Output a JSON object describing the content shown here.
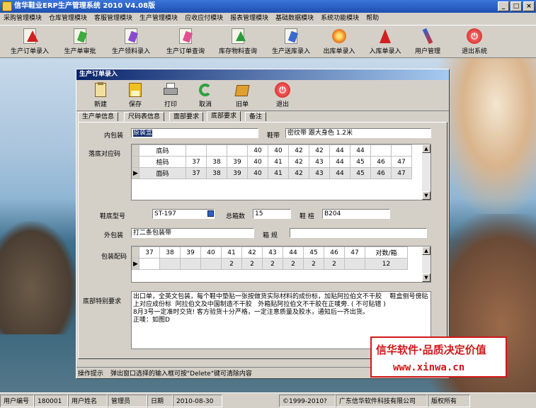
{
  "app": {
    "title": "信华鞋业ERP生产管理系统   2010 V4.08版",
    "controls": [
      "_",
      "□",
      "×"
    ]
  },
  "menu": [
    "采购管理模块",
    "仓库管理模块",
    "客服管理模块",
    "生产管理模块",
    "应收应付模块",
    "报表管理模块",
    "基础数据模块",
    "系统功能模块",
    "帮助"
  ],
  "toolbar": [
    {
      "label": "生产订单录入",
      "icon": "document-red-arrow-icon"
    },
    {
      "label": "生产单审批",
      "icon": "document-green-icon"
    },
    {
      "label": "生产领料录入",
      "icon": "document-purple-icon"
    },
    {
      "label": "生产订单查询",
      "icon": "document-pink-icon"
    },
    {
      "label": "库存物料查询",
      "icon": "document-green-arrow-icon"
    },
    {
      "label": "生产送库录入",
      "icon": "document-blue-icon"
    },
    {
      "label": "出库单录入",
      "icon": "orange-flower-icon"
    },
    {
      "label": "入库单录入",
      "icon": "red-arrow-icon"
    },
    {
      "label": "用户管理",
      "icon": "pen-icon"
    },
    {
      "label": "退出系统",
      "icon": "power-icon"
    }
  ],
  "child": {
    "title": "生产订单录入",
    "buttons": [
      {
        "label": "新建",
        "icon": "clipboard-icon"
      },
      {
        "label": "保存",
        "icon": "save-icon"
      },
      {
        "label": "打印",
        "icon": "printer-icon"
      },
      {
        "label": "取消",
        "icon": "undo-icon"
      },
      {
        "label": "旧单",
        "icon": "books-icon"
      },
      {
        "label": "退出",
        "icon": "power-icon"
      }
    ],
    "tabs": [
      "生产单信息",
      "尺码表信息",
      "面部要求",
      "底部要求",
      "备注"
    ],
    "active_tab": 3
  },
  "form": {
    "inner_pack_label": "内包装",
    "inner_pack_value": "原装盒",
    "shoelace_label": "鞋带",
    "shoelace_value": "密纹带 跟大身色  1.2米",
    "sole_size_label": "落底对应码",
    "size_grid": {
      "rows": [
        {
          "name": "底码",
          "values": [
            "",
            "",
            "",
            "40",
            "40",
            "42",
            "42",
            "44",
            "44",
            "",
            ""
          ],
          "marker": ""
        },
        {
          "name": "楦码",
          "values": [
            "37",
            "38",
            "39",
            "40",
            "41",
            "42",
            "43",
            "44",
            "45",
            "46",
            "47"
          ],
          "marker": ""
        },
        {
          "name": "面码",
          "values": [
            "37",
            "38",
            "39",
            "40",
            "41",
            "42",
            "43",
            "44",
            "45",
            "46",
            "47"
          ],
          "marker": "▶"
        }
      ]
    },
    "sole_model_label": "鞋底型号",
    "sole_model_value": "ST-197",
    "total_boxes_label": "总箱数",
    "total_boxes_value": "15",
    "last_label": "鞋 楦",
    "last_value": "B204",
    "outer_pack_label": "外包装",
    "outer_pack_value": "打二条包装带",
    "box_spec_label": "箱 规",
    "box_spec_value": "",
    "pack_size_label": "包装配码",
    "pack_grid": {
      "headers": [
        "37",
        "38",
        "39",
        "40",
        "41",
        "42",
        "43",
        "44",
        "45",
        "46",
        "47",
        "对数/箱"
      ],
      "row": [
        "",
        "",
        "",
        "",
        "2",
        "2",
        "2",
        "2",
        "2",
        "2",
        "",
        "12"
      ]
    },
    "bottom_req_label": "底部特别要求",
    "bottom_req_text": "出口单，全英文包装，每个鞋中垫贴一张按做货实际材料的成份标，加贴阿拉伯文不干胶    鞋盒侧号傍贴上对应成份标  阿拉伯文及中国制造不干胶   外箱贴阿拉伯文不干胶在正唛旁. ( 不可贴错 )\n8月3号一定准时交货! 客方验货十分严格，一定注意质量及胶水，通知后一齐出货。\n正唛：如图D"
  },
  "op_hint": {
    "label": "操作提示",
    "text": "弹出窗口选择的输入框可按\"Delete\"键可清除内容"
  },
  "status": {
    "user_no_label": "用户编号",
    "user_no": "180001",
    "user_name_label": "用户姓名",
    "user_name": "管理员",
    "date_label": "日期",
    "date": "2010-08-30",
    "copyright": "©1999-2010?",
    "company": "广东信华软件科技有限公司",
    "rights": "版权所有"
  },
  "promo": {
    "line1": "信华软件·品质决定价值",
    "line2": "www.xinwa.cn"
  }
}
